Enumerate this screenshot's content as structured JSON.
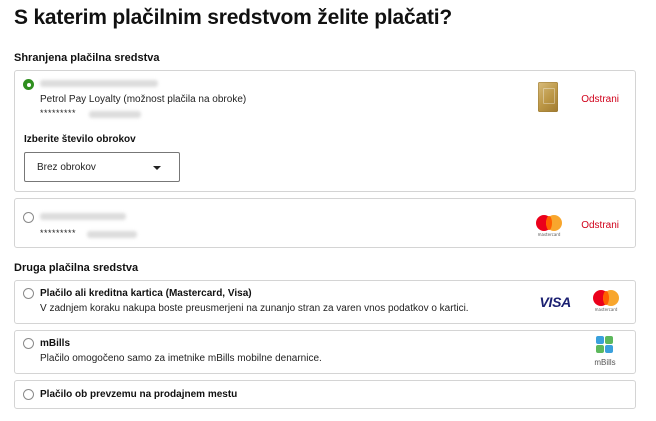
{
  "page": {
    "title": "S katerim plačilnim sredstvom želite plačati?"
  },
  "saved_section": {
    "label": "Shranjena plačilna sredstva"
  },
  "saved_cards": [
    {
      "name": "Petrol Pay Loyalty (možnost plačila na obroke)",
      "masked_number": "*********",
      "remove_label": "Odstrani",
      "selected": true,
      "card_icon": "gold-card-icon",
      "installments": {
        "label": "Izberite število obrokov",
        "value": "Brez obrokov"
      }
    },
    {
      "masked_number": "*********",
      "remove_label": "Odstrani",
      "selected": false,
      "card_icon": "mastercard-icon"
    }
  ],
  "other_section": {
    "label": "Druga plačilna sredstva"
  },
  "other_methods": [
    {
      "title": "Plačilo ali kreditna kartica (Mastercard, Visa)",
      "description": "V zadnjem koraku nakupa boste preusmerjeni na zunanjo stran za varen vnos podatkov o kartici.",
      "icons": [
        "visa-icon",
        "mastercard-icon"
      ],
      "visa_text": "VISA"
    },
    {
      "title": "mBills",
      "description": "Plačilo omogočeno samo za imetnike mBills mobilne denarnice.",
      "icons": [
        "mbills-icon"
      ],
      "logo_text": "mBills"
    },
    {
      "title": "Plačilo ob prevzemu na prodajnem mestu"
    }
  ],
  "brand_marks": {
    "mastercard": "mastercard"
  },
  "colors": {
    "accent_green": "#2f8f1f",
    "remove_red": "#d0021b",
    "border": "#d4d4d4"
  }
}
